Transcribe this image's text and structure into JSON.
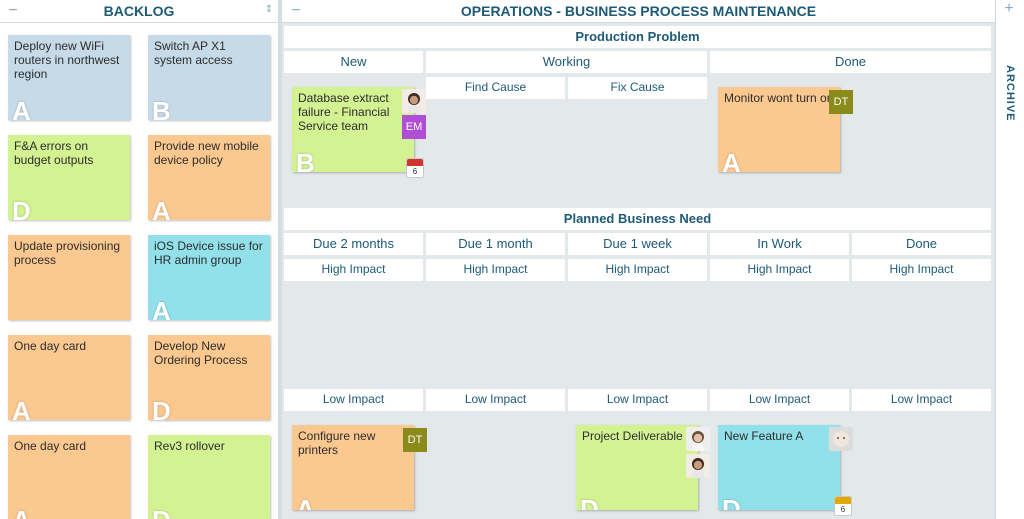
{
  "colors": {
    "blue": "#c6dbe7",
    "green": "#d3f292",
    "orange": "#fbc88f",
    "cyan": "#92e0ea",
    "badge_purple": "#b04fd6",
    "badge_olive": "#8b8b1c",
    "header_text": "#1d5a78"
  },
  "backlog": {
    "title": "BACKLOG",
    "cards": [
      {
        "title": "Deploy new WiFi routers in northwest region",
        "cls": "A",
        "color": "blue"
      },
      {
        "title": "Switch AP X1 system access",
        "cls": "B",
        "color": "blue"
      },
      {
        "title": "F&A errors on budget outputs",
        "cls": "D",
        "color": "green"
      },
      {
        "title": "Provide new mobile device policy",
        "cls": "A",
        "color": "orange"
      },
      {
        "title": "Update provisioning process",
        "cls": "",
        "color": "orange"
      },
      {
        "title": "iOS Device issue for HR admin group",
        "cls": "A",
        "color": "cyan"
      },
      {
        "title": "One day card",
        "cls": "A",
        "color": "orange"
      },
      {
        "title": "Develop New Ordering Process",
        "cls": "D",
        "color": "orange"
      },
      {
        "title": "One day card",
        "cls": "A",
        "color": "orange"
      },
      {
        "title": "Rev3 rollover",
        "cls": "D",
        "color": "green"
      }
    ]
  },
  "board": {
    "title": "OPERATIONS - BUSINESS PROCESS MAINTENANCE",
    "lane1": {
      "title": "Production Problem",
      "col_new": "New",
      "col_working": "Working",
      "col_done": "Done",
      "sub_find": "Find Cause",
      "sub_fix": "Fix Cause"
    },
    "lane2": {
      "title": "Planned Business Need",
      "cols": [
        "Due 2 months",
        "Due 1 month",
        "Due 1 week",
        "In Work",
        "Done"
      ],
      "high": "High Impact",
      "low": "Low Impact"
    },
    "cards": {
      "db": {
        "title": "Database extract failure - Financial Service team",
        "cls": "B",
        "badge": "EM",
        "due": "6"
      },
      "monitor": {
        "title": "Monitor wont turn on",
        "cls": "A",
        "badge": "DT"
      },
      "printers": {
        "title": "Configure new printers",
        "cls": "A",
        "badge": "DT"
      },
      "project": {
        "title": "Project Deliverable",
        "cls": "D"
      },
      "feature": {
        "title": "New Feature A",
        "cls": "D",
        "due": "6"
      }
    }
  },
  "archive": {
    "label": "ARCHIVE"
  }
}
